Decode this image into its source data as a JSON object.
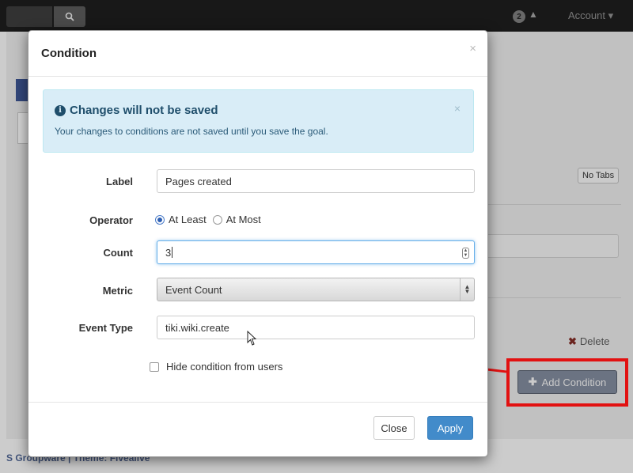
{
  "background": {
    "account_label": "Account ▾",
    "notification_count": "2",
    "no_tabs_label": "No Tabs",
    "delete_label": "Delete",
    "add_condition_label": "Add Condition",
    "footer_text": "S Groupware | Theme: Fivealive"
  },
  "modal": {
    "title": "Condition",
    "close_glyph": "×",
    "alert": {
      "title": "Changes will not be saved",
      "text": "Your changes to conditions are not saved until you save the goal.",
      "close_glyph": "×"
    },
    "form": {
      "label_label": "Label",
      "label_value": "Pages created",
      "operator_label": "Operator",
      "operator_options": [
        "At Least",
        "At Most"
      ],
      "operator_selected": "At Least",
      "count_label": "Count",
      "count_value": "3",
      "metric_label": "Metric",
      "metric_value": "Event Count",
      "event_type_label": "Event Type",
      "event_type_value": "tiki.wiki.create",
      "hide_checkbox_label": "Hide condition from users",
      "hide_checked": false
    },
    "footer": {
      "close_label": "Close",
      "apply_label": "Apply"
    }
  },
  "colors": {
    "primary": "#428bca",
    "alert_bg": "#d9edf7",
    "highlight": "#e21111"
  }
}
